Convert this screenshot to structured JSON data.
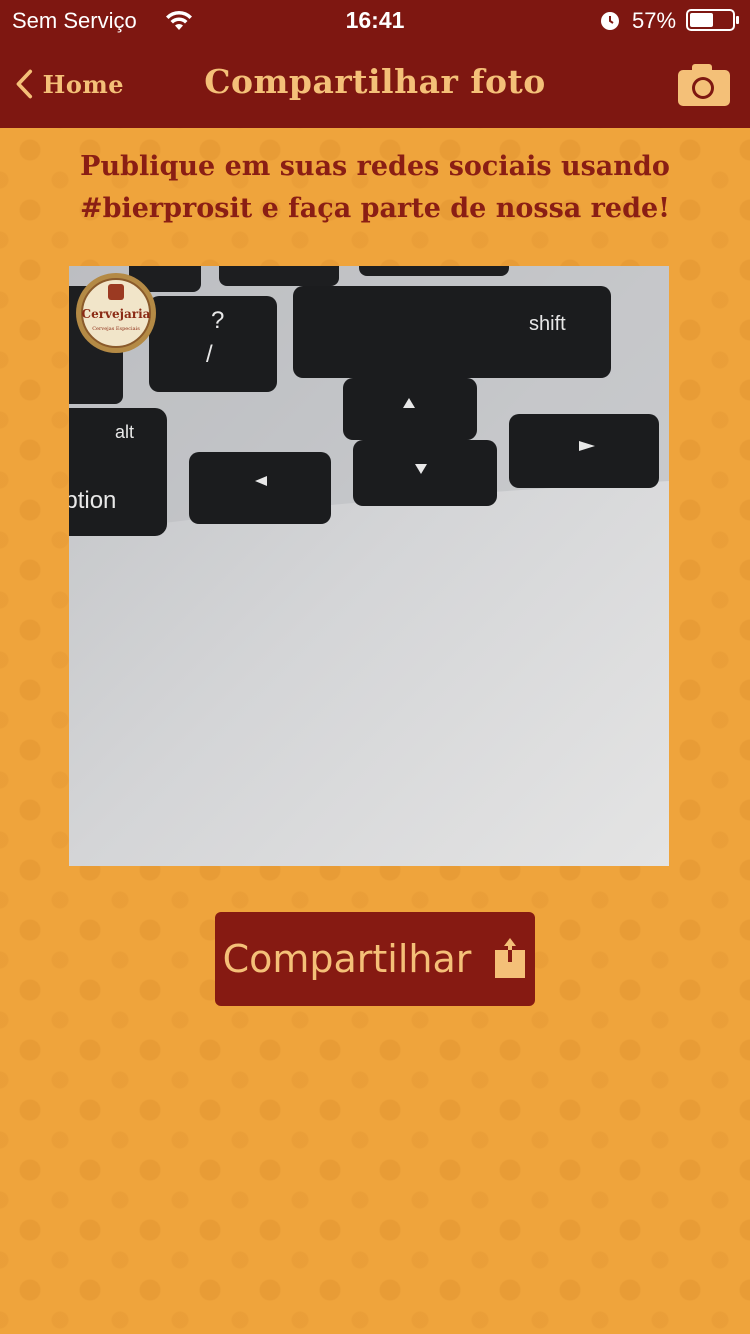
{
  "status_bar": {
    "carrier": "Sem Serviço",
    "time": "16:41",
    "battery": "57%",
    "battery_level": 0.57
  },
  "nav": {
    "back_label": "Home",
    "title": "Compartilhar foto",
    "camera_icon": "camera-icon"
  },
  "headline": "Publique em suas redes sociais usando #bierprosit e faça parte de nossa rede!",
  "photo": {
    "badge_text": "Cervejaria",
    "badge_subtext": "Cervejas Especiais",
    "keys": {
      "question": "?",
      "slash": "/",
      "shift": "shift",
      "alt": "alt",
      "option": "option"
    }
  },
  "share_button": {
    "label": "Compartilhar",
    "icon": "share-icon"
  },
  "colors": {
    "bar": "#7e1711",
    "accent": "#f4c078",
    "background": "#efa43c",
    "button": "#861a12"
  }
}
